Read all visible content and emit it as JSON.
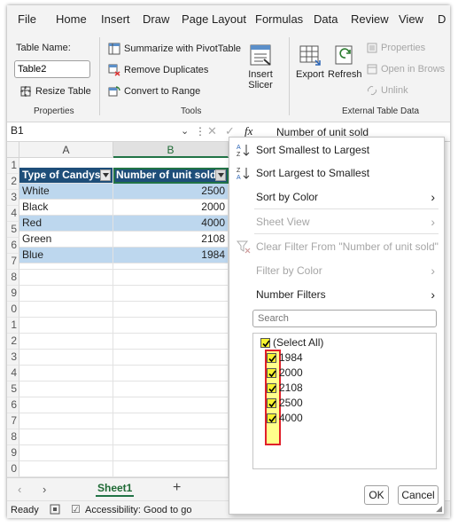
{
  "menu": [
    "File",
    "Home",
    "Insert",
    "Draw",
    "Page Layout",
    "Formulas",
    "Data",
    "Review",
    "View",
    "D"
  ],
  "ribbon": {
    "table_name_label": "Table Name:",
    "table_name_value": "Table2",
    "resize_table": "Resize Table",
    "properties_group": "Properties",
    "summarize_pivot": "Summarize with PivotTable",
    "remove_duplicates": "Remove Duplicates",
    "convert_to_range": "Convert to Range",
    "tools_group": "Tools",
    "insert_slicer_1": "Insert",
    "insert_slicer_2": "Slicer",
    "export": "Export",
    "refresh": "Refresh",
    "properties": "Properties",
    "open_in_browser": "Open in Brows",
    "unlink": "Unlink",
    "external_group": "External Table Data"
  },
  "formula_bar": {
    "name_box": "B1",
    "fx": "fx",
    "content": "Number of unit sold"
  },
  "grid": {
    "col_a": "A",
    "col_b": "B",
    "row_numbers": [
      "1",
      "2",
      "3",
      "4",
      "5",
      "6",
      "7",
      "8",
      "9",
      "0",
      "1",
      "2",
      "3",
      "4",
      "5",
      "6",
      "7",
      "8",
      "9",
      "0"
    ],
    "headers": [
      "Type of Candys",
      "Number of unit sold"
    ],
    "rows": [
      {
        "type": "White",
        "units": "2500"
      },
      {
        "type": "Black",
        "units": "2000"
      },
      {
        "type": "Red",
        "units": "4000"
      },
      {
        "type": "Green",
        "units": "2108"
      },
      {
        "type": "Blue",
        "units": "1984"
      }
    ]
  },
  "sheet_tabs": {
    "active": "Sheet1",
    "add": "+"
  },
  "status": {
    "ready": "Ready",
    "accessibility": "Accessibility: Good to go"
  },
  "filter_menu": {
    "sort_asc": "Sort Smallest to Largest",
    "sort_desc": "Sort Largest to Smallest",
    "sort_by_color": "Sort by Color",
    "sheet_view": "Sheet View",
    "clear_filter": "Clear Filter From \"Number of unit sold\"",
    "filter_by_color": "Filter by Color",
    "number_filters": "Number Filters",
    "search_placeholder": "Search",
    "select_all": "(Select All)",
    "values": [
      "1984",
      "2000",
      "2108",
      "2500",
      "4000"
    ],
    "ok": "OK",
    "cancel": "Cancel"
  },
  "colors": {
    "table_header": "#1e4e79",
    "band": "#bdd7ee",
    "highlight": "#f6f230",
    "highlight_border": "#e0202a"
  }
}
